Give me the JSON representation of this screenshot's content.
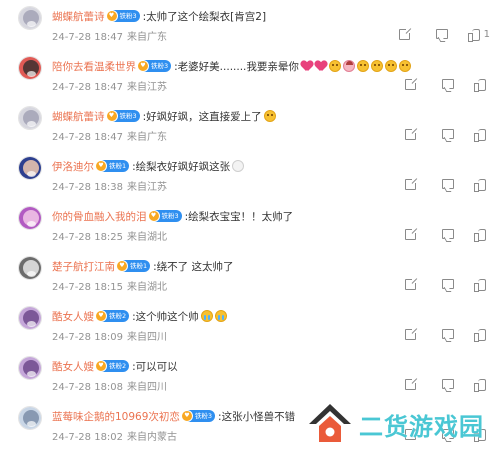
{
  "comments": [
    {
      "username": "蝴蝶航蕾诗",
      "badge": "铁粉3",
      "content": ":太帅了这个绘梨衣[肯宫2]",
      "emojis": [],
      "date": "24-7-28 18:47",
      "location": "来自广东",
      "likes": "1",
      "avatar_colors": [
        "#d7d7df",
        "#a3a3b6"
      ]
    },
    {
      "username": "陪你去看温柔世界",
      "badge": "铁粉3",
      "content": ":老婆好美........我要亲晕你",
      "emojis": [
        "heart",
        "heart",
        "face",
        "beauty",
        "face",
        "face",
        "face",
        "face"
      ],
      "date": "24-7-28 18:47",
      "location": "来自江苏",
      "likes": "",
      "avatar_colors": [
        "#e05a55",
        "#3c3030"
      ]
    },
    {
      "username": "蝴蝶航蕾诗",
      "badge": "铁粉3",
      "content": ":好飒好飒，这直接爱上了",
      "emojis": [
        "face"
      ],
      "date": "24-7-28 18:47",
      "location": "来自广东",
      "likes": "",
      "avatar_colors": [
        "#d7d7df",
        "#a3a3b6"
      ]
    },
    {
      "username": "伊洛迪尔",
      "badge": "铁粉1",
      "content": ":绘梨衣好飒好飒这张",
      "emojis": [
        "bunny"
      ],
      "date": "24-7-28 18:38",
      "location": "来自江苏",
      "likes": "",
      "avatar_colors": [
        "#2d3f8f",
        "#f0c9b0"
      ]
    },
    {
      "username": "你的骨血融入我的泪",
      "badge": "铁粉3",
      "content": ":绘梨衣宝宝！！太帅了",
      "emojis": [],
      "date": "24-7-28 18:25",
      "location": "来自湖北",
      "likes": "",
      "avatar_colors": [
        "#b25ac2",
        "#f2c7e8"
      ]
    },
    {
      "username": "楚子航打江南",
      "badge": "铁粉1",
      "content": ":绕不了 这太帅了",
      "emojis": [],
      "date": "24-7-28 18:15",
      "location": "来自湖北",
      "likes": "",
      "avatar_colors": [
        "#6c6c6c",
        "#e6e6e6"
      ]
    },
    {
      "username": "酷女人嫂",
      "badge": "铁粉2",
      "content": ":这个帅这个帅",
      "emojis": [
        "cry",
        "cry"
      ],
      "date": "24-7-28 18:09",
      "location": "来自四川",
      "likes": "",
      "avatar_colors": [
        "#c5a7d9",
        "#6e4a8c"
      ]
    },
    {
      "username": "酷女人嫂",
      "badge": "铁粉2",
      "content": ":可以可以",
      "emojis": [],
      "date": "24-7-28 18:08",
      "location": "来自四川",
      "likes": "",
      "avatar_colors": [
        "#c5a7d9",
        "#6e4a8c"
      ]
    },
    {
      "username": "蓝莓味企鹅的10969次初恋",
      "badge": "铁粉3",
      "content": ":这张小怪兽不错",
      "emojis": [],
      "date": "24-7-28 18:02",
      "location": "来自内蒙古",
      "likes": "",
      "avatar_colors": [
        "#c9d6e6",
        "#7d8ea8"
      ]
    }
  ],
  "watermark": {
    "text": "二货游戏园",
    "color": "#4ac7d4"
  }
}
